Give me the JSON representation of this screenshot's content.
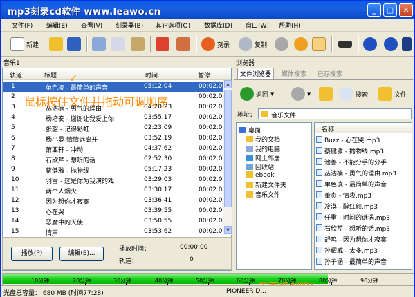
{
  "title": "mp3刻录cd软件 www.leawo.cn",
  "menu": [
    "文件(F)",
    "编辑(E)",
    "查看(V)",
    "刻录器(B)",
    "其它选项(O)",
    "数据库(D)",
    "窗口(W)",
    "帮助(H)"
  ],
  "toolbar": {
    "new_label": "新建",
    "burn_label": "刻录",
    "copy_label": "复制"
  },
  "left_panel": {
    "label": "音乐1",
    "columns": [
      "轨道",
      "标题",
      "时间",
      "暂停"
    ],
    "rows": [
      {
        "track": "1",
        "title": "单色凌 - 最简单的声音",
        "time": "05:12.04",
        "pause": "00:02.0",
        "selected": true
      },
      {
        "track": "2",
        "title": "",
        "time": "",
        "pause": "00:02.0"
      },
      {
        "track": "3",
        "title": "丛浩楠 - 男气的理由",
        "time": "04:20.23",
        "pause": "00:02.0"
      },
      {
        "track": "4",
        "title": "杨培安 - 谢谢让我爱上你",
        "time": "03:55.17",
        "pause": "00:02.0"
      },
      {
        "track": "5",
        "title": "张韶 - 记得彩虹",
        "time": "02:23.09",
        "pause": "00:02.0"
      },
      {
        "track": "6",
        "title": "杨小曼-情情远离开",
        "time": "03:52.19",
        "pause": "00:02.0"
      },
      {
        "track": "7",
        "title": "萧亚轩 - 冲动",
        "time": "04:37.62",
        "pause": "00:02.0"
      },
      {
        "track": "8",
        "title": "石欣芹 - 想听的话",
        "time": "02:52.30",
        "pause": "00:02.0"
      },
      {
        "track": "9",
        "title": "蔡健雅 - 抛物线",
        "time": "05:17.23",
        "pause": "00:02.0"
      },
      {
        "track": "10",
        "title": "羽雪 - 这是你为我演的戏",
        "time": "03:29.03",
        "pause": "00:02.0"
      },
      {
        "track": "11",
        "title": "两个人烟火",
        "time": "03:30.17",
        "pause": "00:02.0"
      },
      {
        "track": "12",
        "title": "因为想你才寂寞",
        "time": "03:36.41",
        "pause": "00:02.0"
      },
      {
        "track": "13",
        "title": "心在哭",
        "time": "03:39.55",
        "pause": "00:02.0"
      },
      {
        "track": "14",
        "title": "恶魔中的天使",
        "time": "03:50.55",
        "pause": "00:02.0"
      },
      {
        "track": "15",
        "title": "情声",
        "time": "03:53.62",
        "pause": "00:02.0"
      }
    ],
    "hint": "鼠标按住文件并拖动可调顺序",
    "play_btn": "播放(P)",
    "edit_btn": "编辑(E)...",
    "play_time_label": "播放时间：",
    "play_time_value": "00:00:00",
    "track_label": "轨道：",
    "track_value": "0"
  },
  "right_panel": {
    "label": "浏览器",
    "tabs": [
      "文件浏览器",
      "媒体搜索",
      "已存搜索"
    ],
    "back_label": "返回",
    "search_label": "搜索",
    "folder_label": "文件",
    "addr_label": "地址：",
    "addr_value": "音乐文件",
    "tree": [
      "桌面",
      "我的文档",
      "我的电脑",
      "网上邻居",
      "回收站",
      "ebook",
      "新建文件夹",
      "音乐文件"
    ],
    "files_header": "名称",
    "files": [
      "Buzz - 心在哭.mp3",
      "蔡健雅 - 抛物线.mp3",
      "池善 - 不能分手的分手",
      "丛浩楠 - 勇气的理由.mp3",
      "单色凌 - 最简单的声音",
      "董贞 - 情衷.mp3",
      "冷漠 - 醉红颜.mp3",
      "任重 - 时间的谜涡.mp3",
      "石欣芹 - 想听的话.mp3",
      "舒鸣 - 因为想你才寂寞",
      "孙耀威 - 太多.mp3",
      "孙子涵 - 最简单的声音"
    ]
  },
  "capacity": {
    "ticks": [
      "10分钟",
      "20分钟",
      "30分钟",
      "40分钟",
      "50分钟",
      "60分钟",
      "70分钟",
      "80分钟",
      "90分钟"
    ],
    "fill_fraction": 0.79,
    "warning": "不要超刻噢!"
  },
  "status": {
    "capacity": "光盘总容量：   680 MB (时间77:28)",
    "drive": "PIONEER  D..."
  }
}
